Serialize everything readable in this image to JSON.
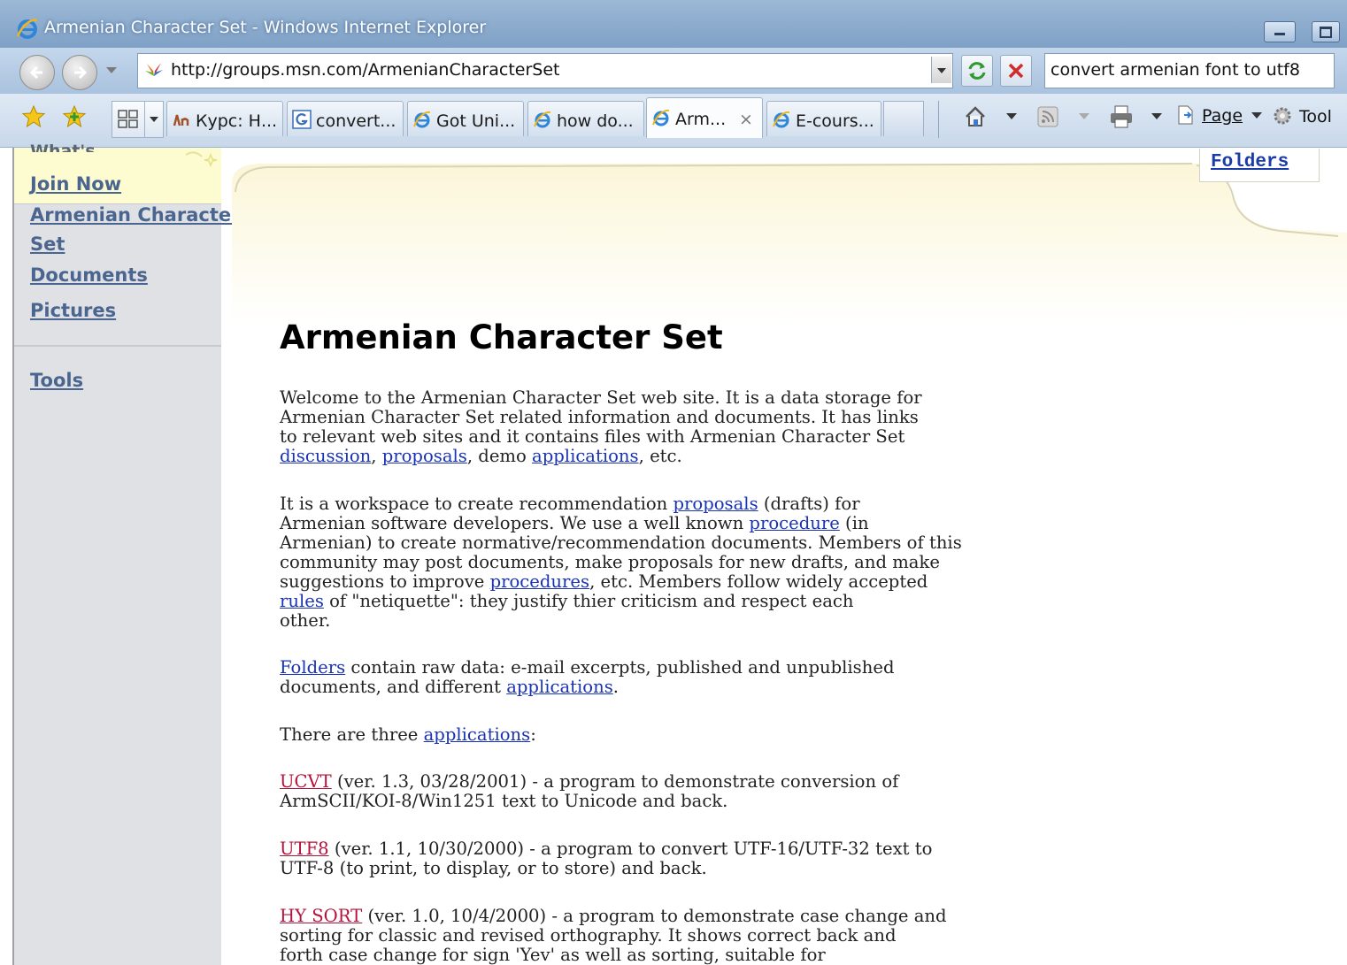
{
  "window": {
    "title": "Armenian Character Set - Windows Internet Explorer"
  },
  "toolbar": {
    "address": "http://groups.msn.com/ArmenianCharacterSet",
    "search_query": "convert armenian font to utf8"
  },
  "tabs": [
    {
      "label": "Курс: Н...",
      "icon": "kurs-site-icon",
      "active": false
    },
    {
      "label": "convert...",
      "icon": "google-icon",
      "active": false
    },
    {
      "label": "Got Uni...",
      "icon": "ie-page-icon",
      "active": false
    },
    {
      "label": "how do...",
      "icon": "ie-page-icon",
      "active": false
    },
    {
      "label": "Arm...",
      "icon": "ie-page-icon",
      "active": true,
      "close": "×"
    },
    {
      "label": "E-cours...",
      "icon": "ie-page-icon",
      "active": false
    }
  ],
  "command_bar": {
    "page_label": "Page",
    "tools_label": "Tool"
  },
  "sidebar": {
    "items": [
      {
        "label": "What's New"
      },
      {
        "label": "Join Now"
      },
      {
        "label": "Armenian Character"
      },
      {
        "label": "Set"
      },
      {
        "label": "Documents"
      },
      {
        "label": "Pictures"
      },
      {
        "label": "Tools"
      }
    ]
  },
  "main": {
    "folders_link": "Folders",
    "title": "Armenian Character Set",
    "p1": {
      "l1": "Welcome to the Armenian Character Set web site. It is a data storage for",
      "l2": "Armenian Character Set related information and documents. It has links",
      "l3": "to relevant web sites and it contains files with Armenian Character Set",
      "link_discussion": "discussion",
      "sep1": ", ",
      "link_proposals": "proposals",
      "sep2": ", demo ",
      "link_applications": "applications",
      "end": ", etc."
    },
    "p2": {
      "l1a": "It is a workspace to create recommendation ",
      "link_proposals": "proposals",
      "l1b": " (drafts) for",
      "l2a": "Armenian software developers. We use a well known ",
      "link_procedure": "procedure",
      "l2b": " (in",
      "l3": "Armenian) to create normative/recommendation documents. Members of this",
      "l4": "community may post documents, make proposals for new drafts, and make",
      "l5a": "suggestions to improve ",
      "link_procedures": "procedures",
      "l5b": ", etc. Members follow widely accepted",
      "link_rules": "rules",
      "l6b": " of \"netiquette\": they justify thier criticism and respect each",
      "l7": "other."
    },
    "p3": {
      "link_folders": "Folders",
      "l1b": " contain raw data: e-mail excerpts, published and unpublished",
      "l2a": "documents, and different ",
      "link_applications": "applications",
      "l2b": "."
    },
    "p4": {
      "l1a": "There are three ",
      "link_applications": "applications",
      "l1b": ":"
    },
    "apps": [
      {
        "name": "UCVT",
        "l1": " (ver. 1.3, 03/28/2001) - a program to demonstrate conversion of",
        "l2": "ArmSCII/KOI-8/Win1251 text to Unicode and back."
      },
      {
        "name": "UTF8",
        "l1": " (ver. 1.1, 10/30/2000) - a program to convert UTF-16/UTF-32 text to",
        "l2": "UTF-8 (to print, to display, or to store) and back."
      },
      {
        "name": "HY SORT",
        "l1": " (ver. 1.0, 10/4/2000) - a program to demonstrate case change and",
        "l2": "sorting for classic and revised orthography. It shows correct back and",
        "l3": "forth case change for sign 'Yev' as well as sorting, suitable for"
      }
    ]
  }
}
